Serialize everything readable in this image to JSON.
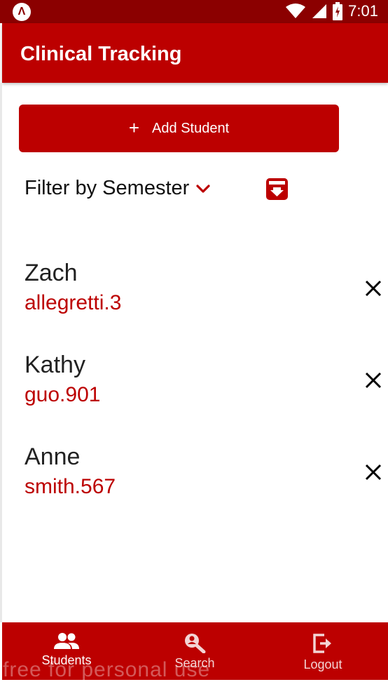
{
  "status_bar": {
    "time": "7:01"
  },
  "app_bar": {
    "title": "Clinical Tracking"
  },
  "add_button": {
    "label": "Add Student"
  },
  "filter": {
    "label": "Filter by Semester"
  },
  "students": [
    {
      "first_name": "Zach",
      "id": "allegretti.3"
    },
    {
      "first_name": "Kathy",
      "id": "guo.901"
    },
    {
      "first_name": "Anne",
      "id": "smith.567"
    }
  ],
  "nav": {
    "students": "Students",
    "search": "Search",
    "logout": "Logout"
  },
  "watermark": "free for personal use",
  "colors": {
    "primary": "#bc0000",
    "status_bar": "#8b0000"
  }
}
